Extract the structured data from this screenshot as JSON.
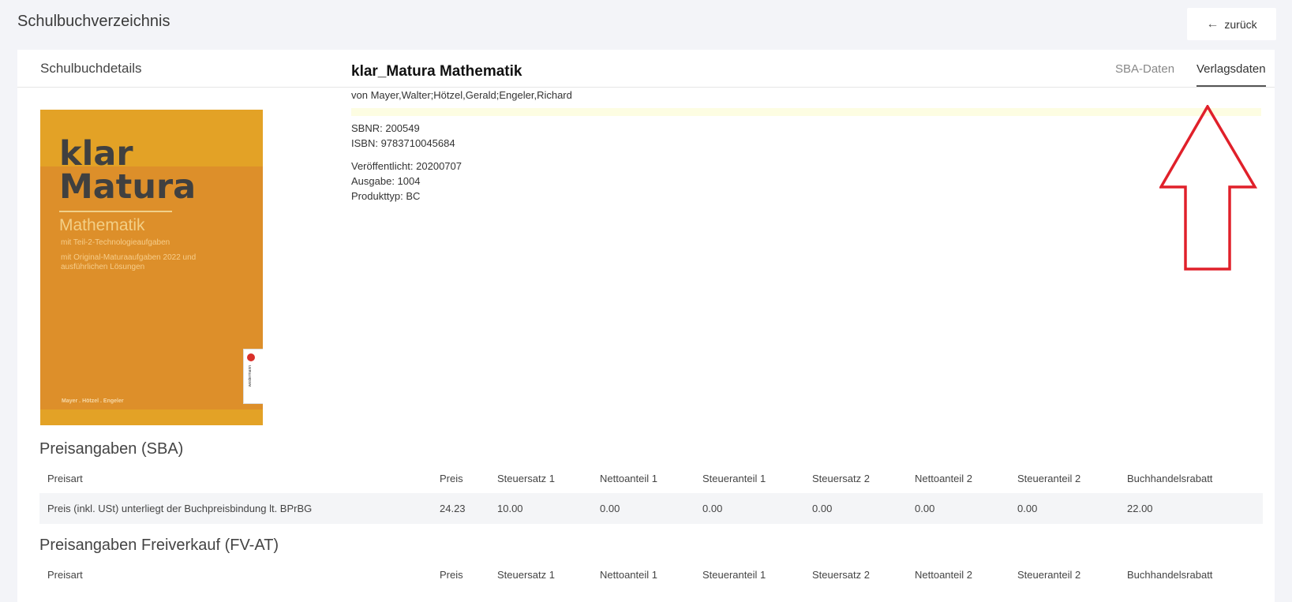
{
  "header": {
    "title": "Schulbuchverzeichnis",
    "back_label": "zurück"
  },
  "card": {
    "title": "Schulbuchdetails",
    "tabs": [
      {
        "label": "SBA-Daten",
        "active": false
      },
      {
        "label": "Verlagsdaten",
        "active": true
      }
    ]
  },
  "cover": {
    "line1": "klar",
    "line2": "Matura",
    "subject": "Mathematik",
    "note1": "mit Teil-2-Technologieaufgaben",
    "note2": "mit Original-Maturaaufgaben 2022 und ausführlichen Lösungen",
    "authors": "Mayer . Hötzel . Engeler",
    "publisher": "westermann",
    "colors": {
      "main": "#dd8f2a",
      "band": "#e3a226"
    }
  },
  "book": {
    "title": "klar_Matura Mathematik",
    "authors": "von Mayer,Walter;Hötzel,Gerald;Engeler,Richard",
    "sbnr": "SBNR: 200549",
    "isbn": "ISBN: 9783710045684",
    "published": "Veröffentlicht: 20200707",
    "edition": "Ausgabe: 1004",
    "product_type": "Produkttyp: BC"
  },
  "annotation": {
    "arrow_color": "#e0202a",
    "points_to": "tab-verlagsdaten"
  },
  "price_sba": {
    "title": "Preisangaben (SBA)",
    "columns": [
      "Preisart",
      "Preis",
      "Steuersatz 1",
      "Nettoanteil 1",
      "Steueranteil 1",
      "Steuersatz 2",
      "Nettoanteil 2",
      "Steueranteil 2",
      "Buchhandelsrabatt"
    ],
    "rows": [
      [
        "Preis (inkl. USt) unterliegt der Buchpreisbindung lt. BPrBG",
        "24.23",
        "10.00",
        "0.00",
        "0.00",
        "0.00",
        "0.00",
        "0.00",
        "22.00"
      ]
    ]
  },
  "price_fv": {
    "title": "Preisangaben Freiverkauf (FV-AT)",
    "columns": [
      "Preisart",
      "Preis",
      "Steuersatz 1",
      "Nettoanteil 1",
      "Steueranteil 1",
      "Steuersatz 2",
      "Nettoanteil 2",
      "Steueranteil 2",
      "Buchhandelsrabatt"
    ],
    "rows": []
  }
}
